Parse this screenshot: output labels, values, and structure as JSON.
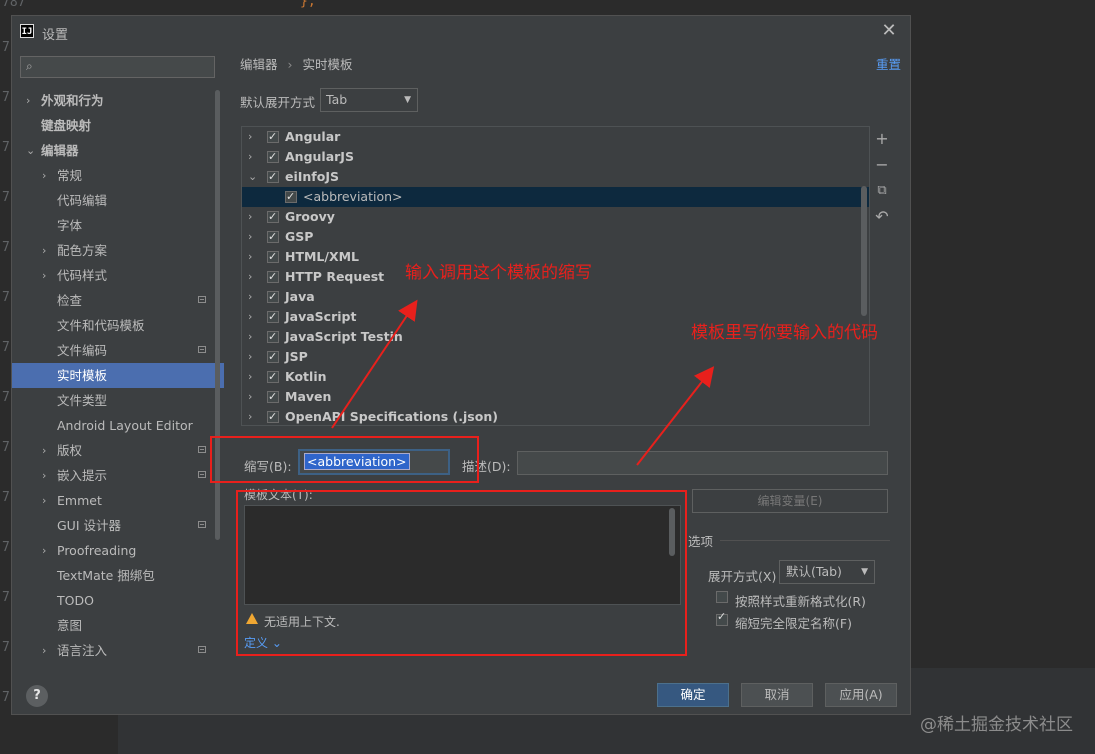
{
  "background_editor": {
    "gutter_numbers": [
      "787",
      "7",
      "7",
      "7",
      "7",
      "7",
      "7",
      "7",
      "7",
      "7",
      "7",
      "7",
      "7",
      "7",
      "7"
    ],
    "code_fragment": "};"
  },
  "dialog": {
    "title": "设置",
    "app_logo": "IJ"
  },
  "sidebar": {
    "search_placeholder": "",
    "items": [
      {
        "label": "外观和行为",
        "level": 0,
        "arrow": "›",
        "bold": true
      },
      {
        "label": "键盘映射",
        "level": 0,
        "arrow": "",
        "bold": true
      },
      {
        "label": "编辑器",
        "level": 0,
        "arrow": "⌄",
        "bold": true
      },
      {
        "label": "常规",
        "level": 1,
        "arrow": "›"
      },
      {
        "label": "代码编辑",
        "level": 1,
        "arrow": ""
      },
      {
        "label": "字体",
        "level": 1,
        "arrow": ""
      },
      {
        "label": "配色方案",
        "level": 1,
        "arrow": "›"
      },
      {
        "label": "代码样式",
        "level": 1,
        "arrow": "›"
      },
      {
        "label": "检查",
        "level": 1,
        "arrow": "",
        "project": true
      },
      {
        "label": "文件和代码模板",
        "level": 1,
        "arrow": ""
      },
      {
        "label": "文件编码",
        "level": 1,
        "arrow": "",
        "project": true
      },
      {
        "label": "实时模板",
        "level": 1,
        "arrow": "",
        "selected": true
      },
      {
        "label": "文件类型",
        "level": 1,
        "arrow": ""
      },
      {
        "label": "Android Layout Editor",
        "level": 1,
        "arrow": ""
      },
      {
        "label": "版权",
        "level": 1,
        "arrow": "›",
        "project": true
      },
      {
        "label": "嵌入提示",
        "level": 1,
        "arrow": "›",
        "project": true
      },
      {
        "label": "Emmet",
        "level": 1,
        "arrow": "›"
      },
      {
        "label": "GUI 设计器",
        "level": 1,
        "arrow": "",
        "project": true
      },
      {
        "label": "Proofreading",
        "level": 1,
        "arrow": "›"
      },
      {
        "label": "TextMate 捆绑包",
        "level": 1,
        "arrow": ""
      },
      {
        "label": "TODO",
        "level": 1,
        "arrow": ""
      },
      {
        "label": "意图",
        "level": 1,
        "arrow": ""
      },
      {
        "label": "语言注入",
        "level": 1,
        "arrow": "›",
        "project": true
      }
    ]
  },
  "header": {
    "breadcrumb_parent": "编辑器",
    "breadcrumb_sep": "›",
    "breadcrumb_current": "实时模板",
    "reset": "重置"
  },
  "default_expand": {
    "label": "默认展开方式",
    "value": "Tab"
  },
  "templates": [
    {
      "name": "Angular",
      "expanded": false,
      "checked": true
    },
    {
      "name": "AngularJS",
      "expanded": false,
      "checked": true
    },
    {
      "name": "eiInfoJS",
      "expanded": true,
      "checked": true
    },
    {
      "name": "<abbreviation>",
      "child": true,
      "checked": true,
      "selected": true
    },
    {
      "name": "Groovy",
      "expanded": false,
      "checked": true
    },
    {
      "name": "GSP",
      "expanded": false,
      "checked": true
    },
    {
      "name": "HTML/XML",
      "expanded": false,
      "checked": true
    },
    {
      "name": "HTTP Request",
      "expanded": false,
      "checked": true
    },
    {
      "name": "Java",
      "expanded": false,
      "checked": true
    },
    {
      "name": "JavaScript",
      "expanded": false,
      "checked": true
    },
    {
      "name": "JavaScript Testin",
      "expanded": false,
      "checked": true
    },
    {
      "name": "JSP",
      "expanded": false,
      "checked": true
    },
    {
      "name": "Kotlin",
      "expanded": false,
      "checked": true
    },
    {
      "name": "Maven",
      "expanded": false,
      "checked": true
    },
    {
      "name": "OpenAPI Specifications (.json)",
      "expanded": false,
      "checked": true
    }
  ],
  "side_tools": [
    "+",
    "−",
    "⧉",
    "↶"
  ],
  "editor": {
    "abbr_label": "缩写(B):",
    "abbr_value": "<abbreviation>",
    "desc_label": "描述(D):",
    "desc_value": "",
    "template_text_label": "模板文本(T):",
    "edit_vars": "编辑变量(E)",
    "warning": "无适用上下文.",
    "define": "定义 ⌄"
  },
  "options": {
    "title": "选项",
    "expand_label": "展开方式(X)",
    "expand_value": "默认(Tab)",
    "reformat_label": "按照样式重新格式化(R)",
    "reformat_checked": false,
    "shorten_label": "缩短完全限定名称(F)",
    "shorten_checked": true
  },
  "footer": {
    "help": "?",
    "ok": "确定",
    "cancel": "取消",
    "apply": "应用(A)"
  },
  "annotations": {
    "note1": "输入调用这个模板的缩写",
    "note2": "模板里写你要输入的代码",
    "color": "#e8201c"
  },
  "watermark": "@稀土掘金技术社区"
}
